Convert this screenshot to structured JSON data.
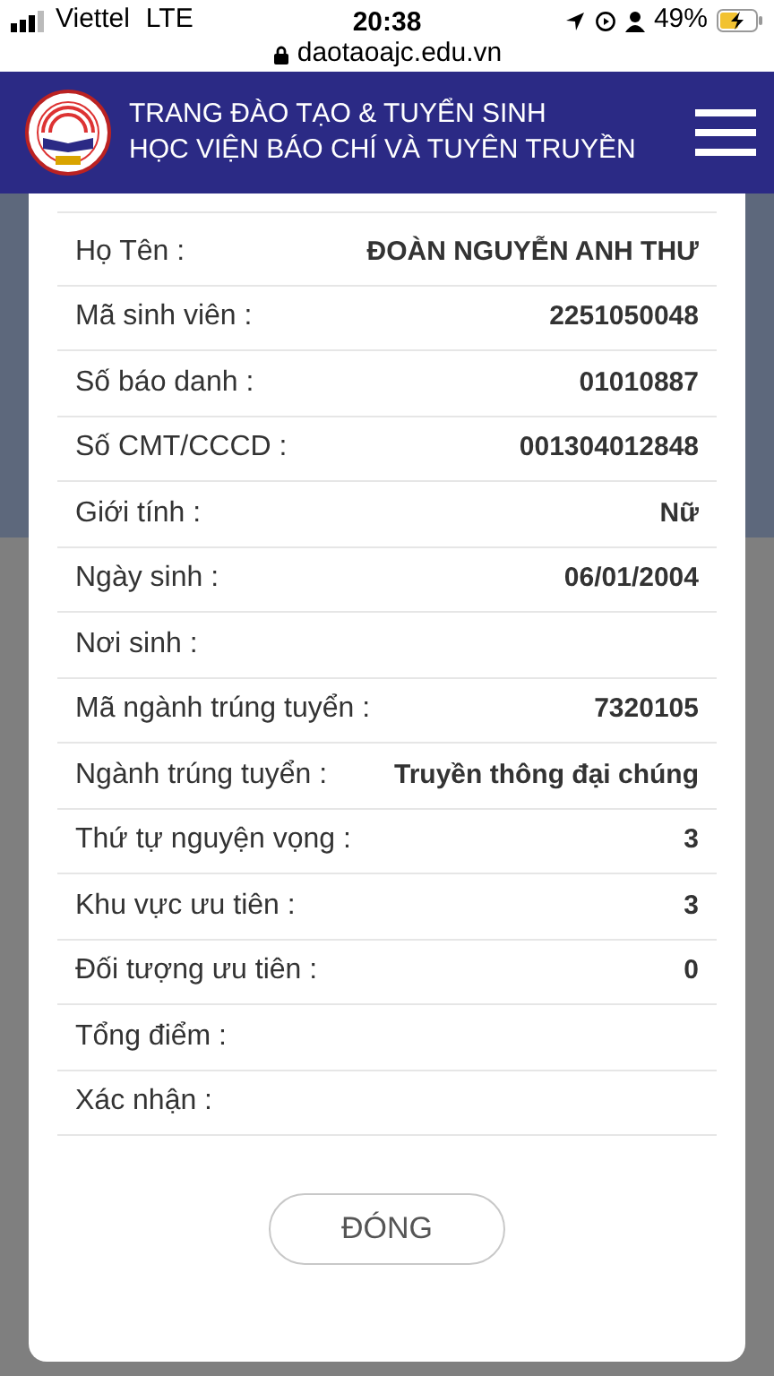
{
  "status_bar": {
    "carrier": "Viettel",
    "network": "LTE",
    "time": "20:38",
    "url": "daotaoajc.edu.vn",
    "battery": "49%"
  },
  "header": {
    "title_line_1": "TRANG ĐÀO TẠO & TUYỂN SINH",
    "title_line_2": "HỌC VIỆN BÁO CHÍ VÀ TUYÊN TRUYỀN"
  },
  "modal": {
    "rows": [
      {
        "label": "Họ Tên :",
        "value": "ĐOÀN NGUYỄN ANH THƯ"
      },
      {
        "label": "Mã sinh viên :",
        "value": "2251050048"
      },
      {
        "label": "Số báo danh :",
        "value": "01010887"
      },
      {
        "label": "Số CMT/CCCD :",
        "value": "001304012848"
      },
      {
        "label": "Giới tính :",
        "value": "Nữ"
      },
      {
        "label": "Ngày sinh :",
        "value": "06/01/2004"
      },
      {
        "label": "Nơi sinh :"
      },
      {
        "label": "Mã ngành trúng tuyển :",
        "value": "7320105"
      },
      {
        "label": "Ngành trúng tuyển :",
        "value": "Truyền thông đại chúng"
      },
      {
        "label": "Thứ tự nguyện vọng :",
        "value": "3"
      },
      {
        "label": "Khu vực ưu tiên :",
        "value": "3"
      },
      {
        "label": "Đối tượng ưu tiên :",
        "value": "0"
      },
      {
        "label": "Tổng điểm :"
      },
      {
        "label": "Xác nhận :"
      }
    ],
    "close_button": "ĐÓNG"
  }
}
